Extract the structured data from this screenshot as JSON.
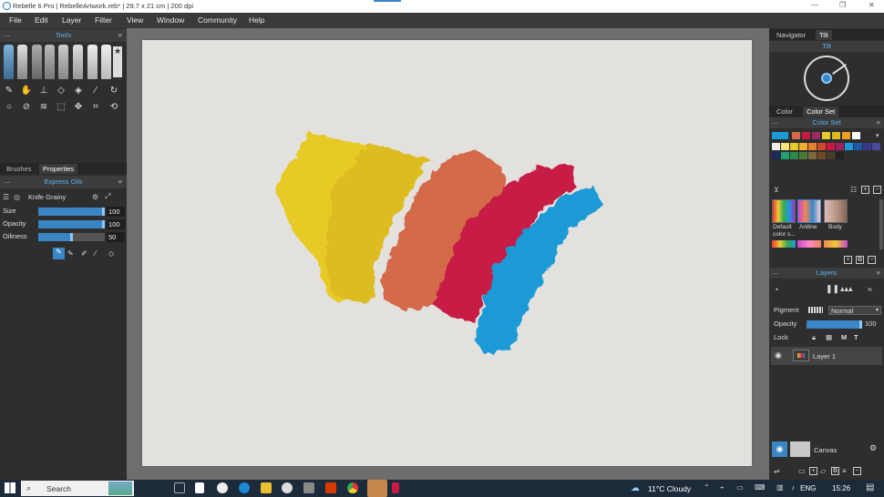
{
  "window": {
    "title": "Rebelle 6 Pro | RebelleArtwork.reb* | 29.7 x 21 cm | 200 dpi"
  },
  "menu": [
    "File",
    "Edit",
    "Layer",
    "Filter",
    "View",
    "Window",
    "Community",
    "Help"
  ],
  "left_panel": {
    "tools_title": "Tools",
    "tabs": [
      "Brushes",
      "Properties"
    ],
    "brush_set": "Express Oils",
    "brush_name": "Knife Grainy",
    "properties": [
      {
        "label": "Size",
        "value": "100",
        "fill": 1.0
      },
      {
        "label": "Opacity",
        "value": "100",
        "fill": 1.0
      },
      {
        "label": "Oiliness",
        "value": "50",
        "fill": 0.5
      }
    ]
  },
  "right_panel": {
    "nav_tabs": [
      "Navigator",
      "Tilt"
    ],
    "tilt_title": "Tilt",
    "color_tabs": [
      "Color",
      "Color Set"
    ],
    "color_set_title": "Color Set",
    "sets": [
      {
        "label": "Default color s..."
      },
      {
        "label": "Aniline"
      },
      {
        "label": "Body"
      }
    ],
    "layers_title": "Layers",
    "pigment_label": "Pigment",
    "blend_mode": "Normal",
    "opacity_label": "Opacity",
    "opacity_value": "100",
    "lock_label": "Lock",
    "layer_name": "Layer 1",
    "canvas_label": "Canvas",
    "accent_color": "#5cb3f0"
  },
  "taskbar": {
    "search_placeholder": "Search",
    "weather": "11°C  Cloudy",
    "lang": "ENG",
    "time": "15:26"
  }
}
